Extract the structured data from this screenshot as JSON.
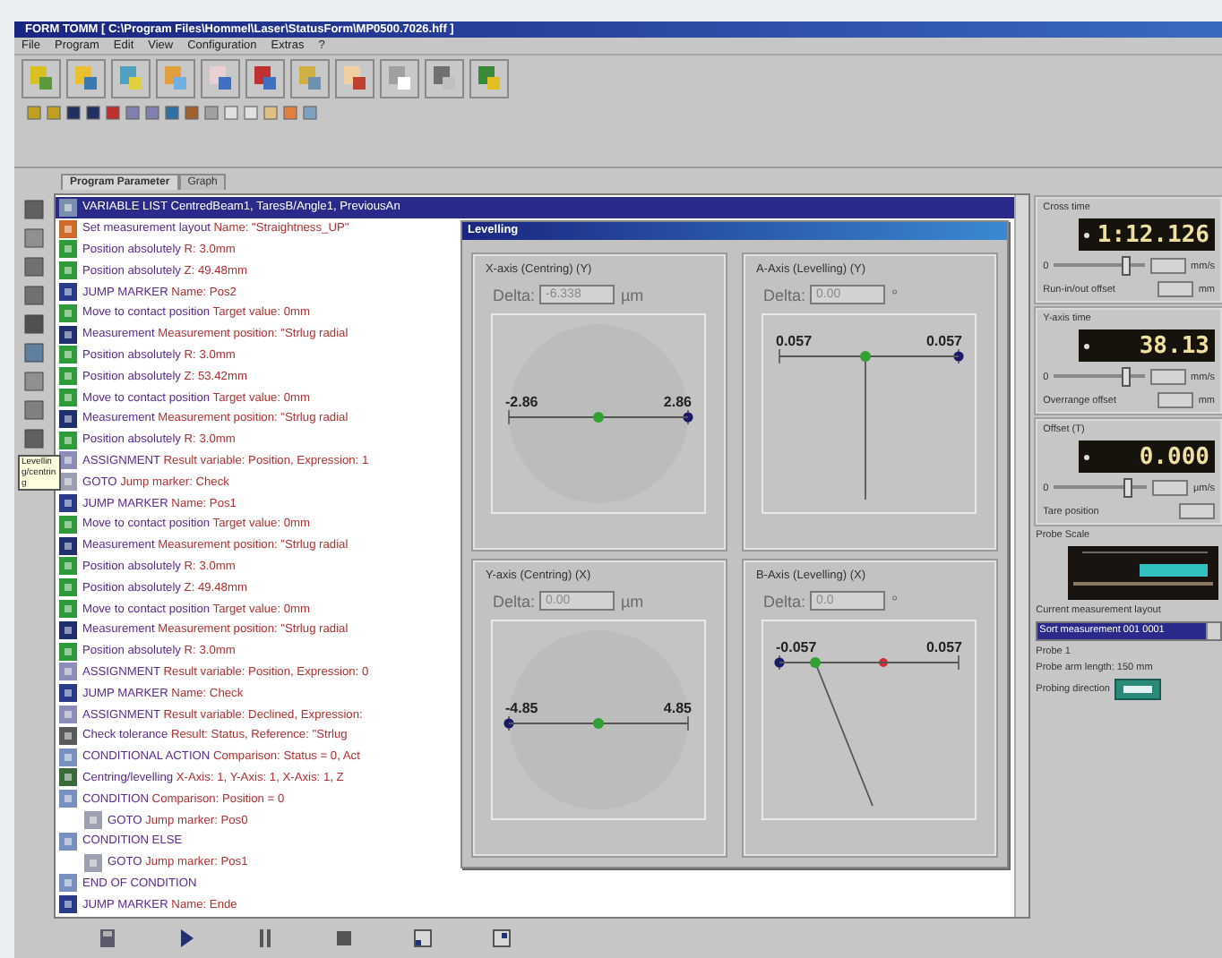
{
  "window": {
    "title": "FORM TOMM [ C:\\Program Files\\Hommel\\Laser\\StatusForm\\MP0500.7026.hff ]"
  },
  "menu": [
    "File",
    "Program",
    "Edit",
    "View",
    "Configuration",
    "Extras",
    "?"
  ],
  "tabs": [
    {
      "label": "Program Parameter",
      "selected": true
    },
    {
      "label": "Graph",
      "selected": false
    }
  ],
  "tooltip": "Levelling/centring",
  "program": [
    {
      "kind": "variable",
      "command": "VARIABLE LIST",
      "params": "CentredBeam1, TaresB/Angle1, PreviousAn",
      "selected": true
    },
    {
      "kind": "layout",
      "command": "Set measurement layout",
      "params": "Name: \"Straightness_UP\"",
      "selected": false
    },
    {
      "kind": "move",
      "command": "Position absolutely",
      "params": "R: 3.0mm",
      "selected": false
    },
    {
      "kind": "move",
      "command": "Position absolutely",
      "params": "Z: 49.48mm",
      "selected": false
    },
    {
      "kind": "jump",
      "command": "JUMP MARKER",
      "params": "Name: Pos2",
      "selected": false
    },
    {
      "kind": "move",
      "command": "Move to contact position",
      "params": "Target value: 0mm",
      "selected": false
    },
    {
      "kind": "measure",
      "command": "Measurement",
      "params": "Measurement position: \"Strlug radial",
      "selected": false
    },
    {
      "kind": "move",
      "command": "Position absolutely",
      "params": "R: 3.0mm",
      "selected": false
    },
    {
      "kind": "move",
      "command": "Position absolutely",
      "params": "Z: 53.42mm",
      "selected": false
    },
    {
      "kind": "move",
      "command": "Move to contact position",
      "params": "Target value: 0mm",
      "selected": false
    },
    {
      "kind": "measure",
      "command": "Measurement",
      "params": "Measurement position: \"Strlug radial",
      "selected": false
    },
    {
      "kind": "move",
      "command": "Position absolutely",
      "params": "R: 3.0mm",
      "selected": false
    },
    {
      "kind": "assign",
      "command": "ASSIGNMENT",
      "params": "Result variable: Position, Expression: 1",
      "selected": false
    },
    {
      "kind": "goto",
      "command": "GOTO",
      "params": "Jump marker: Check",
      "selected": false
    },
    {
      "kind": "jump",
      "command": "JUMP MARKER",
      "params": "Name: Pos1",
      "selected": false
    },
    {
      "kind": "move",
      "command": "Move to contact position",
      "params": "Target value: 0mm",
      "selected": false
    },
    {
      "kind": "measure",
      "command": "Measurement",
      "params": "Measurement position: \"Strlug radial",
      "selected": false
    },
    {
      "kind": "move",
      "command": "Position absolutely",
      "params": "R: 3.0mm",
      "selected": false
    },
    {
      "kind": "move",
      "command": "Position absolutely",
      "params": "Z: 49.48mm",
      "selected": false
    },
    {
      "kind": "move",
      "command": "Move to contact position",
      "params": "Target value: 0mm",
      "selected": false
    },
    {
      "kind": "measure",
      "command": "Measurement",
      "params": "Measurement position: \"Strlug radial",
      "selected": false
    },
    {
      "kind": "move",
      "command": "Position absolutely",
      "params": "R: 3.0mm",
      "selected": false
    },
    {
      "kind": "assign",
      "command": "ASSIGNMENT",
      "params": "Result variable: Position, Expression: 0",
      "selected": false
    },
    {
      "kind": "jump",
      "command": "JUMP MARKER",
      "params": "Name: Check",
      "selected": false
    },
    {
      "kind": "assign",
      "command": "ASSIGNMENT",
      "params": "Result variable: Declined, Expression:",
      "selected": false
    },
    {
      "kind": "check",
      "command": "Check tolerance",
      "params": "Result: Status, Reference: \"Strlug",
      "selected": false
    },
    {
      "kind": "condition",
      "command": "CONDITIONAL ACTION",
      "params": "Comparison: Status = 0, Act",
      "selected": false
    },
    {
      "kind": "levelling",
      "command": "Centring/levelling",
      "params": "X-Axis: 1, Y-Axis: 1, X-Axis: 1, Z",
      "selected": false
    },
    {
      "kind": "condition",
      "command": "CONDITION",
      "params": "Comparison: Position = 0",
      "selected": false,
      "children": [
        {
          "kind": "goto",
          "command": "GOTO",
          "params": "Jump marker: Pos0",
          "selected": false
        }
      ]
    },
    {
      "kind": "condition",
      "command": "CONDITION ELSE",
      "selected": false,
      "children": [
        {
          "kind": "goto",
          "command": "GOTO",
          "params": "Jump marker: Pos1",
          "selected": false
        }
      ]
    },
    {
      "kind": "condition",
      "command": "END OF CONDITION",
      "selected": false
    },
    {
      "kind": "jump",
      "command": "JUMP MARKER",
      "params": "Name: Ende",
      "selected": false
    }
  ],
  "dialog": {
    "title": "Levelling",
    "panels": [
      {
        "kind": "centring",
        "title": "X-axis (Centring) (Y)",
        "delta_label": "Delta:",
        "delta": "-6.338",
        "unit": "µm",
        "min": "-2.86",
        "max": "2.86",
        "level": 0.5,
        "marker_left": false,
        "tilted": false
      },
      {
        "kind": "levelling",
        "title": "A-Axis (Levelling) (Y)",
        "delta_label": "Delta:",
        "delta": "0.00",
        "unit": "°",
        "min": "0.057",
        "max": "0.057",
        "level": 0.48,
        "marker_left": false,
        "tilted": false
      },
      {
        "kind": "centring",
        "title": "Y-axis (Centring) (X)",
        "delta_label": "Delta:",
        "delta": "0.00",
        "unit": "µm",
        "min": "-4.85",
        "max": "4.85",
        "level": 0.5,
        "marker_left": true,
        "tilted": false
      },
      {
        "kind": "levelling",
        "title": "B-Axis (Levelling) (X)",
        "delta_label": "Delta:",
        "delta": "0.0",
        "unit": "°",
        "min": "-0.057",
        "max": "0.057",
        "level": 0.2,
        "marker_left": true,
        "tilted": true
      }
    ]
  },
  "displays": [
    {
      "title": "Cross time",
      "reading": "1:12.126",
      "scale_start": "0",
      "level": 0.85,
      "unit": "mm/s",
      "offset_label": "Run-in/out offset",
      "offset_unit": "mm"
    },
    {
      "title": "Y-axis time",
      "reading": "38.13",
      "scale_start": "0",
      "level": 0.85,
      "unit": "mm/s",
      "offset_label": "Overrange offset",
      "offset_unit": "mm"
    },
    {
      "title": "Offset (T)",
      "reading": "0.000",
      "scale_start": "0",
      "level": 0.85,
      "unit": "µm/s",
      "offset_label": "Tare position"
    }
  ],
  "probe_scale": {
    "title": "Probe Scale"
  },
  "layout": {
    "label": "Current measurement layout",
    "value": "Sort measurement 001 0001",
    "probe": "Probe 1",
    "arm_length": "Probe arm length: 150 mm",
    "direction_label": "Probing direction"
  }
}
